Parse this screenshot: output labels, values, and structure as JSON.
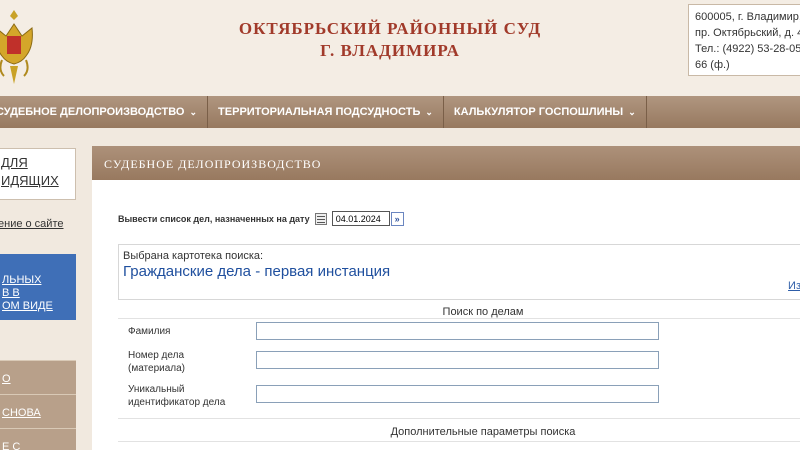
{
  "header": {
    "court_line1": "ОКТЯБРЬСКИЙ РАЙОННЫЙ СУД",
    "court_line2": "Г. ВЛАДИМИРА",
    "address_line1": "600005, г. Владимир,",
    "address_line2": "пр. Октябрьский, д. 4",
    "address_line3": "Тел.: (4922) 53-28-05,",
    "address_line4": "66 (ф.)"
  },
  "nav": {
    "items": [
      {
        "label": "СУДЕБНОЕ ДЕЛОПРОИЗВОДСТВО"
      },
      {
        "label": "ТЕРРИТОРИАЛЬНАЯ ПОДСУДНОСТЬ"
      },
      {
        "label": "КАЛЬКУЛЯТОР ГОСПОШЛИНЫ"
      }
    ],
    "chevron": "⌄"
  },
  "sidebar": {
    "visitors_line1": "ДЛЯ",
    "visitors_line2": "ИДЯЩИХ",
    "site_info": "ение о сайте",
    "blue_line1": "ЛЬНЫХ",
    "blue_line2": "В В",
    "blue_line3": "ОМ ВИДЕ",
    "items": [
      {
        "label": "О"
      },
      {
        "label": "СНОВА"
      },
      {
        "label": "Е С"
      }
    ]
  },
  "main": {
    "section_title": "СУДЕБНОЕ ДЕЛОПРОИЗВОДСТВО",
    "date_label": "Вывести список дел, назначенных на дату",
    "date_value": "04.01.2024",
    "go_symbol": "»",
    "selected_label": "Выбрана картотека поиска:",
    "selected_value": "Гражданские дела - первая инстанция",
    "change_link": "Из",
    "search_title": "Поиск по делам",
    "fields": [
      {
        "label_line1": "Фамилия",
        "label_line2": "",
        "value": ""
      },
      {
        "label_line1": "Номер дела",
        "label_line2": "(материала)",
        "value": ""
      },
      {
        "label_line1": "Уникальный",
        "label_line2": "идентификатор дела",
        "value": ""
      }
    ],
    "advanced_title": "Дополнительные параметры поиска"
  }
}
